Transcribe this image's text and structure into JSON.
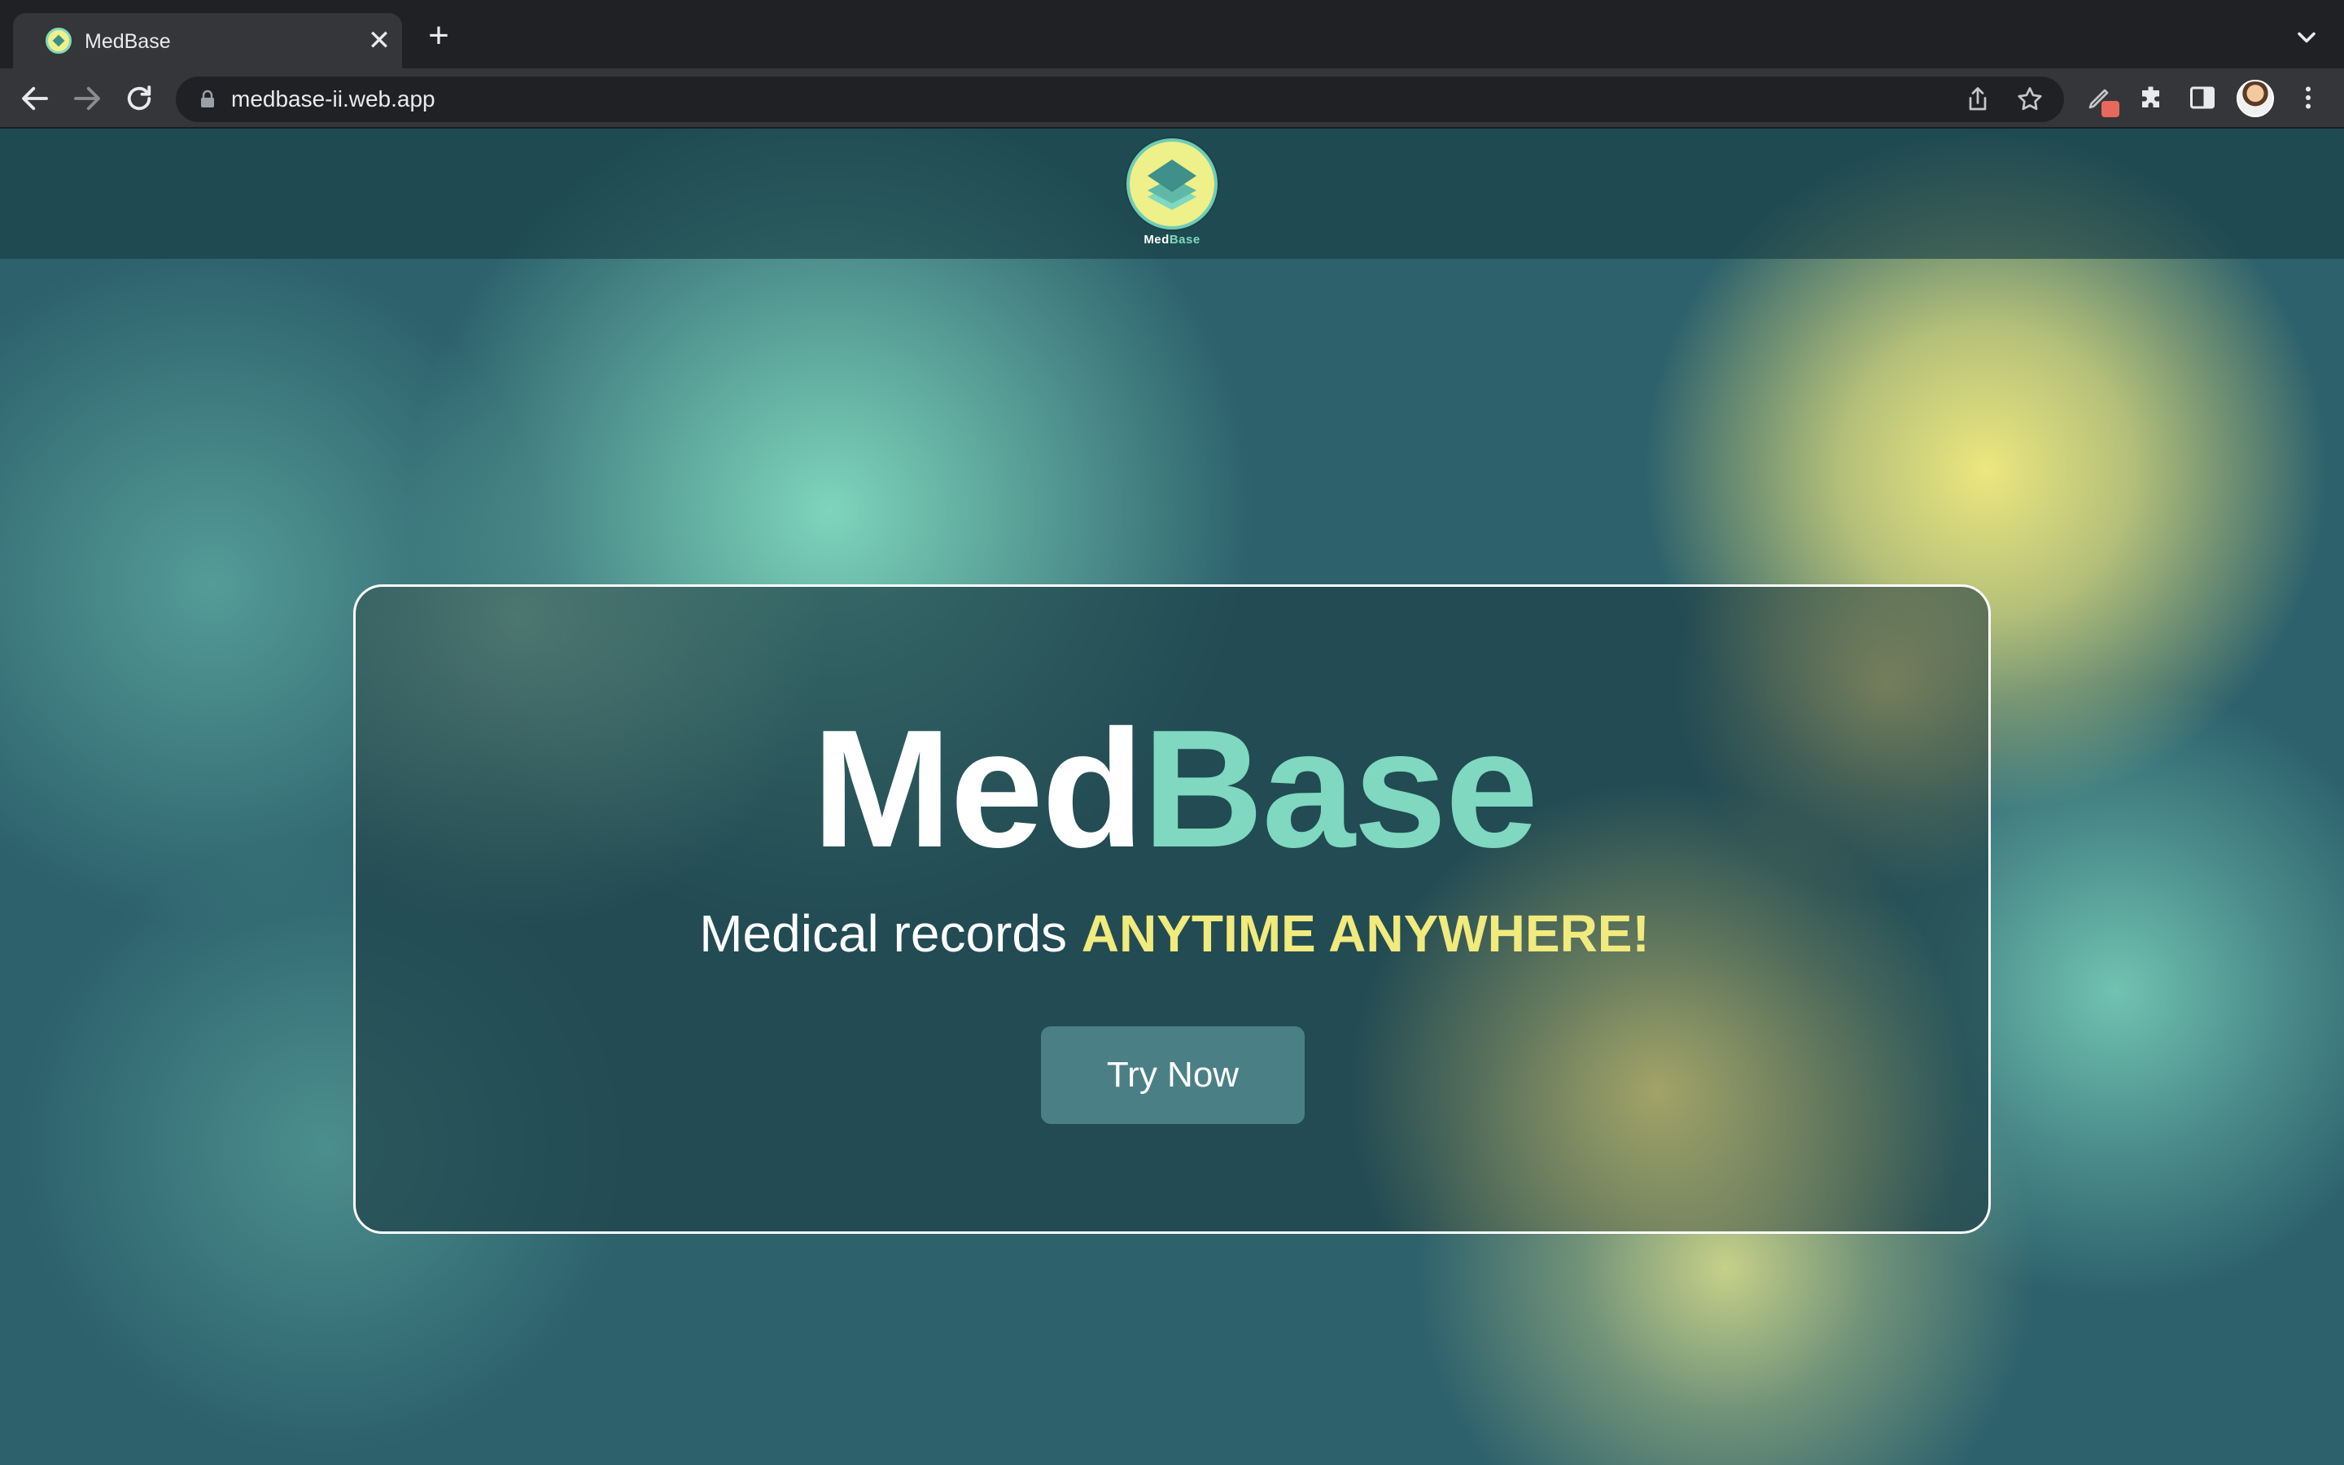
{
  "browser": {
    "tab_title": "MedBase",
    "tab_close": "✕",
    "new_tab": "+",
    "url": "medbase-ii.web.app",
    "icons": [
      "back-icon",
      "forward-icon",
      "reload-icon",
      "lock-icon",
      "share-icon",
      "star-icon",
      "pen-extension-icon",
      "puzzle-icon",
      "side-panel-icon",
      "avatar",
      "kebab-menu-icon",
      "tab-search-chevron-icon"
    ]
  },
  "header": {
    "logo_label_med": "Med",
    "logo_label_base": "Base"
  },
  "hero": {
    "title_med": "Med",
    "title_base": "Base",
    "tagline_prefix": "Medical records ",
    "tagline_highlight": "ANYTIME ANYWHERE!",
    "cta_label": "Try Now"
  },
  "colors": {
    "accent_teal": "#7fd8bf",
    "accent_yellow": "#f1ea7d",
    "button_bg": "#4b7f86",
    "page_bg": "#2d616c"
  }
}
